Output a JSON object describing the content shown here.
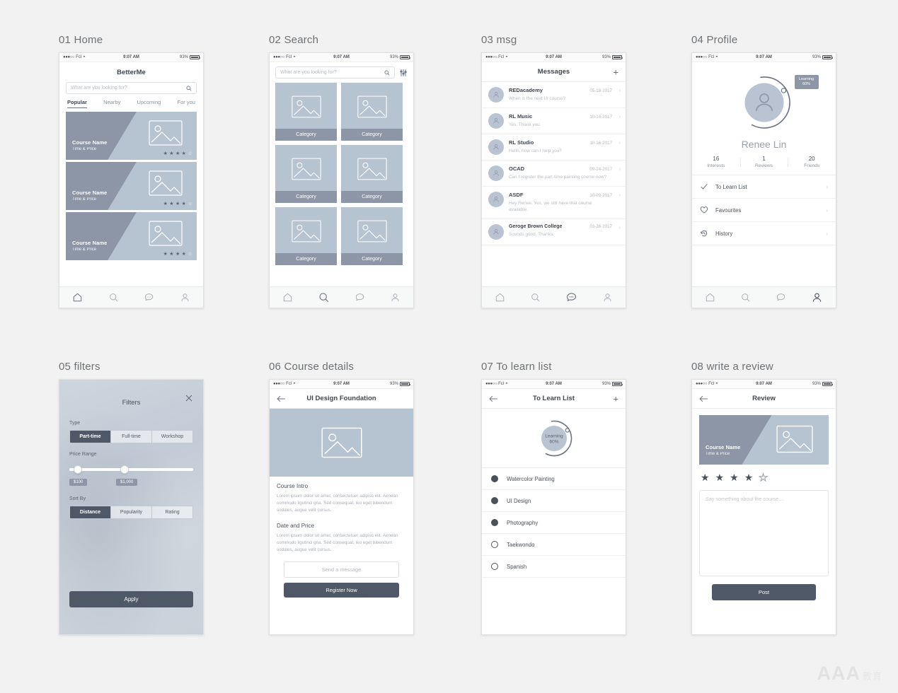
{
  "statusbar": {
    "carrier": "Fcl",
    "time": "9:07 AM",
    "battery": "93%",
    "dots": "●●●○○",
    "wifi": "wifi-icon"
  },
  "screens": {
    "home": {
      "title": "01 Home",
      "appname": "BetterMe",
      "search_placeholder": "What are you looking for?",
      "tabs": [
        "Popular",
        "Nearby",
        "Upcoming",
        "For you"
      ],
      "active_tab": "Popular",
      "cards": [
        {
          "name": "Course Name",
          "meta": "Time & Price",
          "rating": 4
        },
        {
          "name": "Course Name",
          "meta": "Time & Price",
          "rating": 4
        },
        {
          "name": "Course Name",
          "meta": "Time & Price",
          "rating": 4
        }
      ]
    },
    "search": {
      "title": "02 Search",
      "search_placeholder": "What are you looking for?",
      "filter_icon": "sliders-icon",
      "tiles": [
        "Category",
        "Category",
        "Category",
        "Category",
        "Category",
        "Category"
      ]
    },
    "msg": {
      "title": "03 msg",
      "navtitle": "Messages",
      "add_label": "+",
      "rows": [
        {
          "name": "REDacademy",
          "date": "05-18-2017",
          "preview": "When is the next UI course?"
        },
        {
          "name": "RL Music",
          "date": "10-14-2017",
          "preview": "Yes. Thank you."
        },
        {
          "name": "RL Studio",
          "date": "10-16-2017",
          "preview": "Hello, how can I help you?"
        },
        {
          "name": "OCAD",
          "date": "09-24-2017",
          "preview": "Can I register the part-time painting course now?"
        },
        {
          "name": "ASDF",
          "date": "10-09-2017",
          "preview": "Hey Renee. Yes, we still have that course available."
        },
        {
          "name": "Geroge Brown College",
          "date": "03-26-2017",
          "preview": "Sounds good. Thanks."
        }
      ]
    },
    "profile": {
      "title": "04 Profile",
      "name": "Renee Lin",
      "progress_label": "Learning",
      "progress_value": "60%",
      "progress_percent": 60,
      "stats": [
        {
          "value": "16",
          "label": "Interests"
        },
        {
          "value": "1",
          "label": "Reviews"
        },
        {
          "value": "20",
          "label": "Friends"
        }
      ],
      "menu": [
        {
          "icon": "check-icon",
          "label": "To Learn List"
        },
        {
          "icon": "heart-icon",
          "label": "Favourites"
        },
        {
          "icon": "history-icon",
          "label": "History"
        }
      ]
    },
    "filters": {
      "title": "05 filters",
      "heading": "Filters",
      "close_icon": "close-icon",
      "type_label": "Type",
      "type_options": [
        "Part-time",
        "Full-time",
        "Workshop"
      ],
      "type_selected": "Part-time",
      "price_label": "Price Range",
      "price_min": "$100",
      "price_max": "$1,000",
      "sort_label": "Sort By",
      "sort_options": [
        "Distance",
        "Popularity",
        "Rating"
      ],
      "sort_selected": "Distance",
      "apply_label": "Apply"
    },
    "detail": {
      "title": "06 Course details",
      "navtitle": "UI Design Foundation",
      "back_icon": "back-arrow-icon",
      "intro_heading": "Course Intro",
      "intro_body": "Lorem ipsum dolor sit amet, consectetuer adipisc elit. Aenean commodo ligutinci gna. Sed consequat, leo eget bibendum sodales, augue velit cursus.",
      "price_heading": "Date and Price",
      "price_body": "Lorem ipsum dolor sit amet, consectetuer adipisc elit. Aenean commodo ligutinci gna. Sed consequat, leo eget bibendum sodales, augue velit cursus.",
      "message_label": "Send a message",
      "register_label": "Register Now"
    },
    "tolearn": {
      "title": "07 To learn list",
      "navtitle": "To Learn List",
      "back_icon": "back-arrow-icon",
      "add_label": "+",
      "progress_label": "Learning",
      "progress_value": "60%",
      "progress_percent": 60,
      "items": [
        {
          "label": "Watercolor Painting",
          "done": true
        },
        {
          "label": "UI Design",
          "done": true
        },
        {
          "label": "Photography",
          "done": true
        },
        {
          "label": "Taekwondo",
          "done": false
        },
        {
          "label": "Spanish",
          "done": false
        }
      ]
    },
    "review": {
      "title": "08 write a review",
      "navtitle": "Review",
      "back_icon": "back-arrow-icon",
      "course_name": "Course Name",
      "course_meta": "Time & Price",
      "rating": 4,
      "max_rating": 5,
      "textarea_placeholder": "Say something about the course....",
      "post_label": "Post"
    }
  },
  "watermark": {
    "text": "AAA",
    "cn": "教育"
  },
  "colors": {
    "card_dark": "#8d96a6",
    "card_light": "#b6c3d1",
    "button": "#4f5866",
    "page_bg": "#f2f2f2"
  }
}
